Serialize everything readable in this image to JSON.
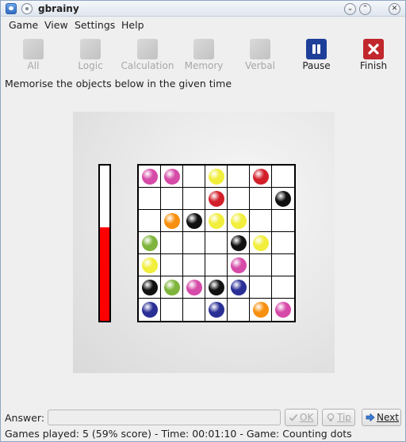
{
  "window": {
    "title": "gbrainy"
  },
  "menu": [
    {
      "label": "Game",
      "underline": "G"
    },
    {
      "label": "View",
      "underline": "V"
    },
    {
      "label": "Settings",
      "underline": "S"
    },
    {
      "label": "Help",
      "underline": "H"
    }
  ],
  "toolbar": [
    {
      "label": "All",
      "enabled": false,
      "icon": "all-icon"
    },
    {
      "label": "Logic",
      "enabled": false,
      "icon": "logic-icon"
    },
    {
      "label": "Calculation",
      "enabled": false,
      "icon": "calculation-icon"
    },
    {
      "label": "Memory",
      "enabled": false,
      "icon": "memory-icon"
    },
    {
      "label": "Verbal",
      "enabled": false,
      "icon": "verbal-icon"
    },
    {
      "label": "Pause",
      "enabled": true,
      "icon": "pause-icon",
      "color": "#1d3f99"
    },
    {
      "label": "Finish",
      "enabled": true,
      "icon": "finish-icon",
      "color": "#c1272d"
    }
  ],
  "instruction": "Memorise the objects below in the given time",
  "game": {
    "timer_remaining_fraction": 0.6,
    "timer_color": "#ff0000",
    "colors": {
      "P": "#d64aa8",
      "Y": "#f1ee3c",
      "R": "#d21f2a",
      "B": "#111111",
      "O": "#f7900e",
      "G": "#7fb53c",
      "N": "#2a2f96"
    },
    "grid": [
      [
        "P",
        "P",
        "",
        "Y",
        "",
        "R",
        ""
      ],
      [
        "",
        "",
        "",
        "R",
        "",
        "",
        "B"
      ],
      [
        "",
        "O",
        "B",
        "Y",
        "Y",
        "",
        ""
      ],
      [
        "G",
        "",
        "",
        "",
        "B",
        "Y",
        ""
      ],
      [
        "Y",
        "",
        "",
        "",
        "P",
        "",
        ""
      ],
      [
        "B",
        "G",
        "P",
        "B",
        "N",
        "",
        ""
      ],
      [
        "N",
        "",
        "",
        "N",
        "",
        "O",
        "P"
      ]
    ]
  },
  "answer": {
    "label": "Answer:",
    "value": "",
    "ok_label": "OK",
    "tip_label": "Tip",
    "next_label": "Next"
  },
  "status": "Games played: 5 (59% score) - Time: 00:01:10 - Game: Counting dots"
}
